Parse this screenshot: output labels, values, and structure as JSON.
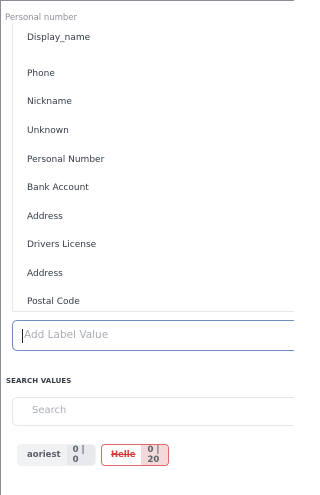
{
  "field": {
    "header": "Personal number"
  },
  "dropdown": {
    "options": [
      "Display_name",
      "Phone",
      "Nickname",
      "Unknown",
      "Personal Number",
      "Bank Account",
      "Address",
      "Drivers License",
      "Address",
      "Postal Code"
    ]
  },
  "label_input": {
    "placeholder": "Add Label Value"
  },
  "search": {
    "title": "SEARCH VALUES",
    "placeholder": "Search",
    "chips": [
      {
        "name": "aoriest",
        "count": "0 | 0",
        "struck": false
      },
      {
        "name": "Helle",
        "count": "0 | 20",
        "struck": true
      }
    ]
  },
  "colors": {
    "focus_border": "#6f8fc4",
    "chip_alert_border": "#e36a6a",
    "chip_alert_text": "#d43c3c"
  }
}
